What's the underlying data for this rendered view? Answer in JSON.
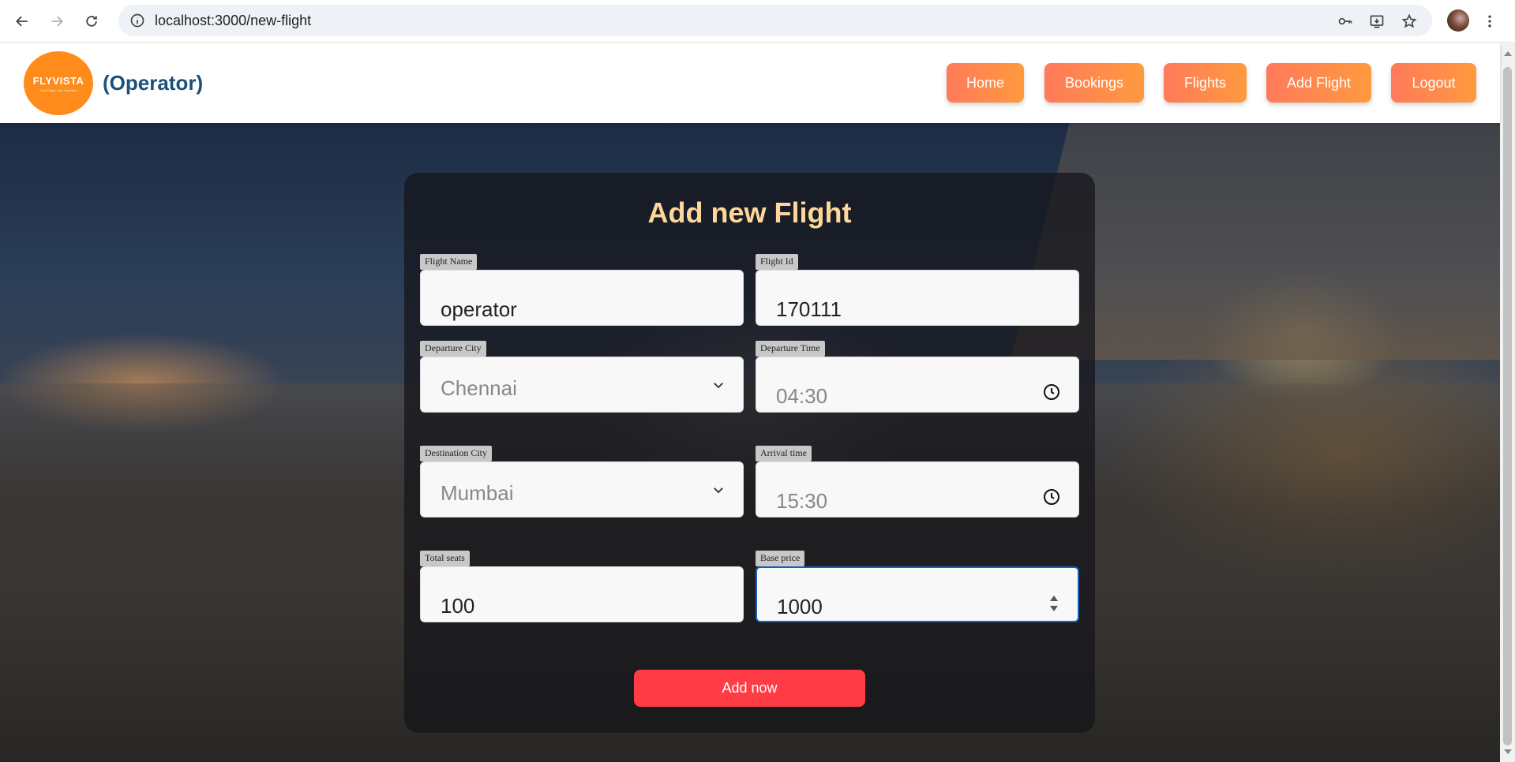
{
  "browser": {
    "url": "localhost:3000/new-flight"
  },
  "header": {
    "logo_text": "FLYVISTA",
    "logo_sub": "Your Flight, Your Freedom",
    "role_label": "(Operator)",
    "nav": [
      {
        "label": "Home"
      },
      {
        "label": "Bookings"
      },
      {
        "label": "Flights"
      },
      {
        "label": "Add Flight"
      },
      {
        "label": "Logout"
      }
    ]
  },
  "form": {
    "title": "Add new Flight",
    "flight_name": {
      "label": "Flight Name",
      "value": "operator"
    },
    "flight_id": {
      "label": "Flight Id",
      "value": "170111"
    },
    "departure_city": {
      "label": "Departure City",
      "value": "Chennai"
    },
    "departure_time": {
      "label": "Departure Time",
      "value": "04:30"
    },
    "destination_city": {
      "label": "Destination City",
      "value": "Mumbai"
    },
    "arrival_time": {
      "label": "Arrival time",
      "value": "15:30"
    },
    "total_seats": {
      "label": "Total seats",
      "value": "100"
    },
    "base_price": {
      "label": "Base price",
      "value": "1000"
    },
    "submit_label": "Add now"
  },
  "colors": {
    "accent": "#ff3b45",
    "nav_gradient_start": "#ff7a5a",
    "nav_gradient_end": "#ff9a3e",
    "title": "#ffd79a",
    "role_label": "#1d4f7a"
  }
}
